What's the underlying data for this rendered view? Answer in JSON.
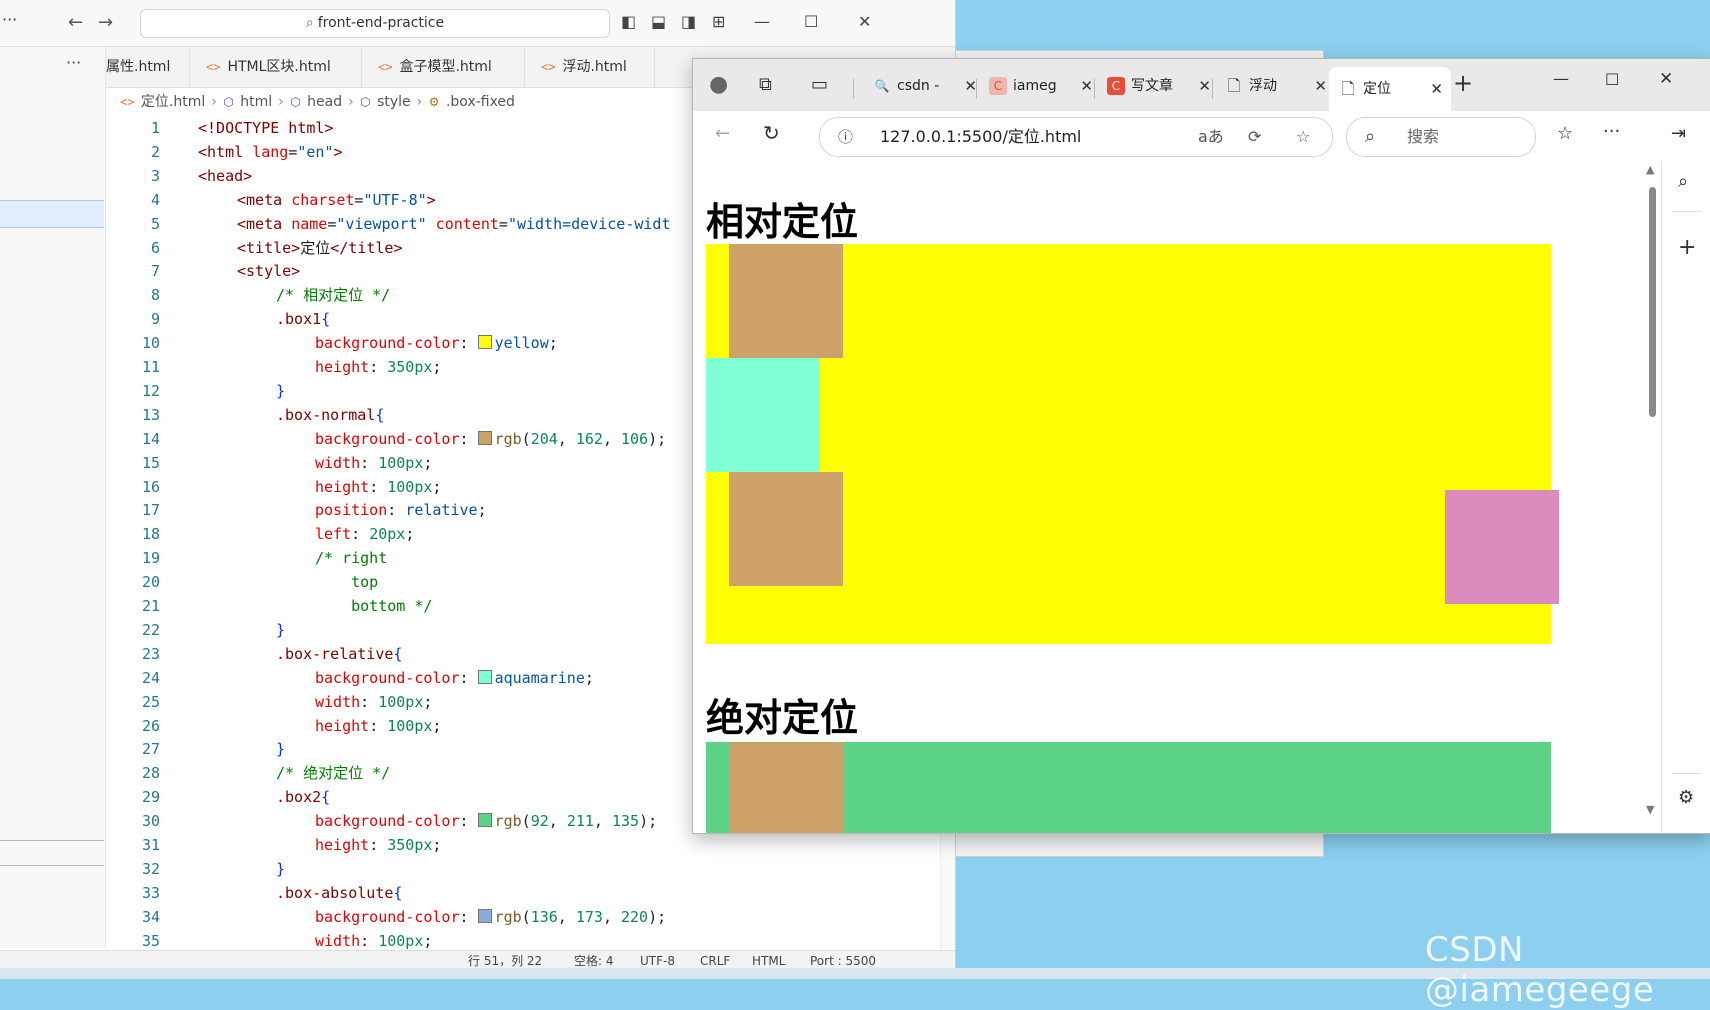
{
  "editor": {
    "title_dots": "···",
    "search_text": "front-end-practice",
    "sidebar_more": "···",
    "tabs": [
      {
        "label": "属性.html",
        "icon": ""
      },
      {
        "label": "HTML区块.html",
        "icon": "<>"
      },
      {
        "label": "盒子模型.html",
        "icon": "<>"
      },
      {
        "label": "浮动.html",
        "icon": "<>"
      }
    ],
    "breadcrumb": {
      "file": "定位.html",
      "html": "html",
      "head": "head",
      "style": "style",
      "rule": ".box-fixed"
    },
    "status": [
      "行 51，列 22",
      "空格: 4",
      "UTF-8",
      "CRLF",
      "HTML",
      "Port : 5500"
    ]
  },
  "code_lines": [
    {
      "n": "1"
    },
    {
      "n": "2"
    },
    {
      "n": "3"
    },
    {
      "n": "4"
    },
    {
      "n": "5"
    },
    {
      "n": "6"
    },
    {
      "n": "7"
    },
    {
      "n": "8"
    },
    {
      "n": "9"
    },
    {
      "n": "10"
    },
    {
      "n": "11"
    },
    {
      "n": "12"
    },
    {
      "n": "13"
    },
    {
      "n": "14"
    },
    {
      "n": "15"
    },
    {
      "n": "16"
    },
    {
      "n": "17"
    },
    {
      "n": "18"
    },
    {
      "n": "19"
    },
    {
      "n": "20"
    },
    {
      "n": "21"
    },
    {
      "n": "22"
    },
    {
      "n": "23"
    },
    {
      "n": "24"
    },
    {
      "n": "25"
    },
    {
      "n": "26"
    },
    {
      "n": "27"
    },
    {
      "n": "28"
    },
    {
      "n": "29"
    },
    {
      "n": "30"
    },
    {
      "n": "31"
    },
    {
      "n": "32"
    },
    {
      "n": "33"
    },
    {
      "n": "34"
    },
    {
      "n": "35"
    }
  ],
  "code": {
    "l1": "<!DOCTYPE html>",
    "l2a": "<html ",
    "l2b": "lang",
    "l2c": "=",
    "l2d": "\"en\"",
    "l2e": ">",
    "l3": "<head>",
    "l4a": "<meta ",
    "l4b": "charset",
    "l4c": "=",
    "l4d": "\"UTF-8\"",
    "l4e": ">",
    "l5a": "<meta ",
    "l5b": "name",
    "l5c": "=",
    "l5d": "\"viewport\"",
    "l5e": " content",
    "l5f": "=",
    "l5g": "\"width=device-widt",
    "l6a": "<title>",
    "l6b": "定位",
    "l6c": "</title>",
    "l7": "<style>",
    "l8": "/* 相对定位 */",
    "l9a": ".box1",
    "l9b": "{",
    "l10a": "background-color",
    "l10b": ": ",
    "l10c": "yellow",
    "l10d": ";",
    "l11a": "height",
    "l11b": ": ",
    "l11c": "350px",
    "l11d": ";",
    "l12": "}",
    "l13a": ".box-normal",
    "l13b": "{",
    "l14a": "background-color",
    "l14b": ": ",
    "l14c": "rgb",
    "l14d": "(",
    "l14e": "204",
    "l14f": ", ",
    "l14g": "162",
    "l14h": ", ",
    "l14i": "106",
    "l14j": ");",
    "l15a": "width",
    "l15b": ": ",
    "l15c": "100px",
    "l15d": ";",
    "l16a": "height",
    "l16b": ": ",
    "l16c": "100px",
    "l16d": ";",
    "l17a": "position",
    "l17b": ": ",
    "l17c": "relative",
    "l17d": ";",
    "l18a": "left",
    "l18b": ": ",
    "l18c": "20px",
    "l18d": ";",
    "l19": "/* right",
    "l20": "    top",
    "l21": "    bottom */",
    "l22": "}",
    "l23a": ".box-relative",
    "l23b": "{",
    "l24a": "background-color",
    "l24b": ": ",
    "l24c": "aquamarine",
    "l24d": ";",
    "l25a": "width",
    "l25b": ": ",
    "l25c": "100px",
    "l25d": ";",
    "l26a": "height",
    "l26b": ": ",
    "l26c": "100px",
    "l26d": ";",
    "l27": "}",
    "l28": "/* 绝对定位 */",
    "l29a": ".box2",
    "l29b": "{",
    "l30a": "background-color",
    "l30b": ": ",
    "l30c": "rgb",
    "l30d": "(",
    "l30e": "92",
    "l30f": ", ",
    "l30g": "211",
    "l30h": ", ",
    "l30i": "135",
    "l30j": ");",
    "l31a": "height",
    "l31b": ": ",
    "l31c": "350px",
    "l31d": ";",
    "l32": "}",
    "l33a": ".box-absolute",
    "l33b": "{",
    "l34a": "background-color",
    "l34b": ": ",
    "l34c": "rgb",
    "l34d": "(",
    "l34e": "136",
    "l34f": ", ",
    "l34g": "173",
    "l34h": ", ",
    "l34i": "220",
    "l34j": ");",
    "l35a": "width",
    "l35b": ": ",
    "l35c": "100px",
    "l35d": ";"
  },
  "browser": {
    "tabs": [
      {
        "label": "csdn -",
        "favicon": "🔍"
      },
      {
        "label": "iameg",
        "favicon": "C"
      },
      {
        "label": "写文章",
        "favicon": "C"
      },
      {
        "label": "浮动",
        "favicon": "🗋"
      },
      {
        "label": "定位",
        "favicon": "🗋"
      }
    ],
    "new_tab": "+",
    "url": "127.0.0.1:5500/定位.html",
    "search_placeholder": "搜索",
    "read_aloud": "aあ"
  },
  "page": {
    "heading1": "相对定位",
    "heading2": "绝对定位"
  },
  "colors": {
    "yellow": "#ffff00",
    "tan": "#cca26a",
    "aquamarine": "#7fffd4",
    "pink": "#dc8bbf",
    "green": "#5cd387",
    "accent_c": "#e94d3a"
  },
  "watermark": "CSDN @iamegeege"
}
